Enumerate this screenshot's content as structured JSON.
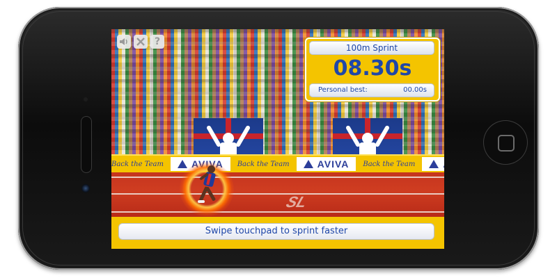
{
  "game": {
    "event_label": "100m Sprint",
    "timer": "08.30s",
    "personal_best_label": "Personal best:",
    "personal_best_value": "00.00s",
    "prompt": "Swipe touchpad to sprint faster"
  },
  "controls": [
    {
      "name": "sound-icon",
      "glyph": "speaker"
    },
    {
      "name": "close-icon",
      "glyph": "x"
    },
    {
      "name": "help-icon",
      "glyph": "?"
    }
  ],
  "adboard": {
    "brand": "AVIVA",
    "slogan": "Back the Team"
  },
  "track_marking": "SL",
  "colors": {
    "accent_yellow": "#f4c400",
    "text_blue": "#1f47a8",
    "track_red": "#c5341e",
    "panel_white": "#ffffff"
  }
}
